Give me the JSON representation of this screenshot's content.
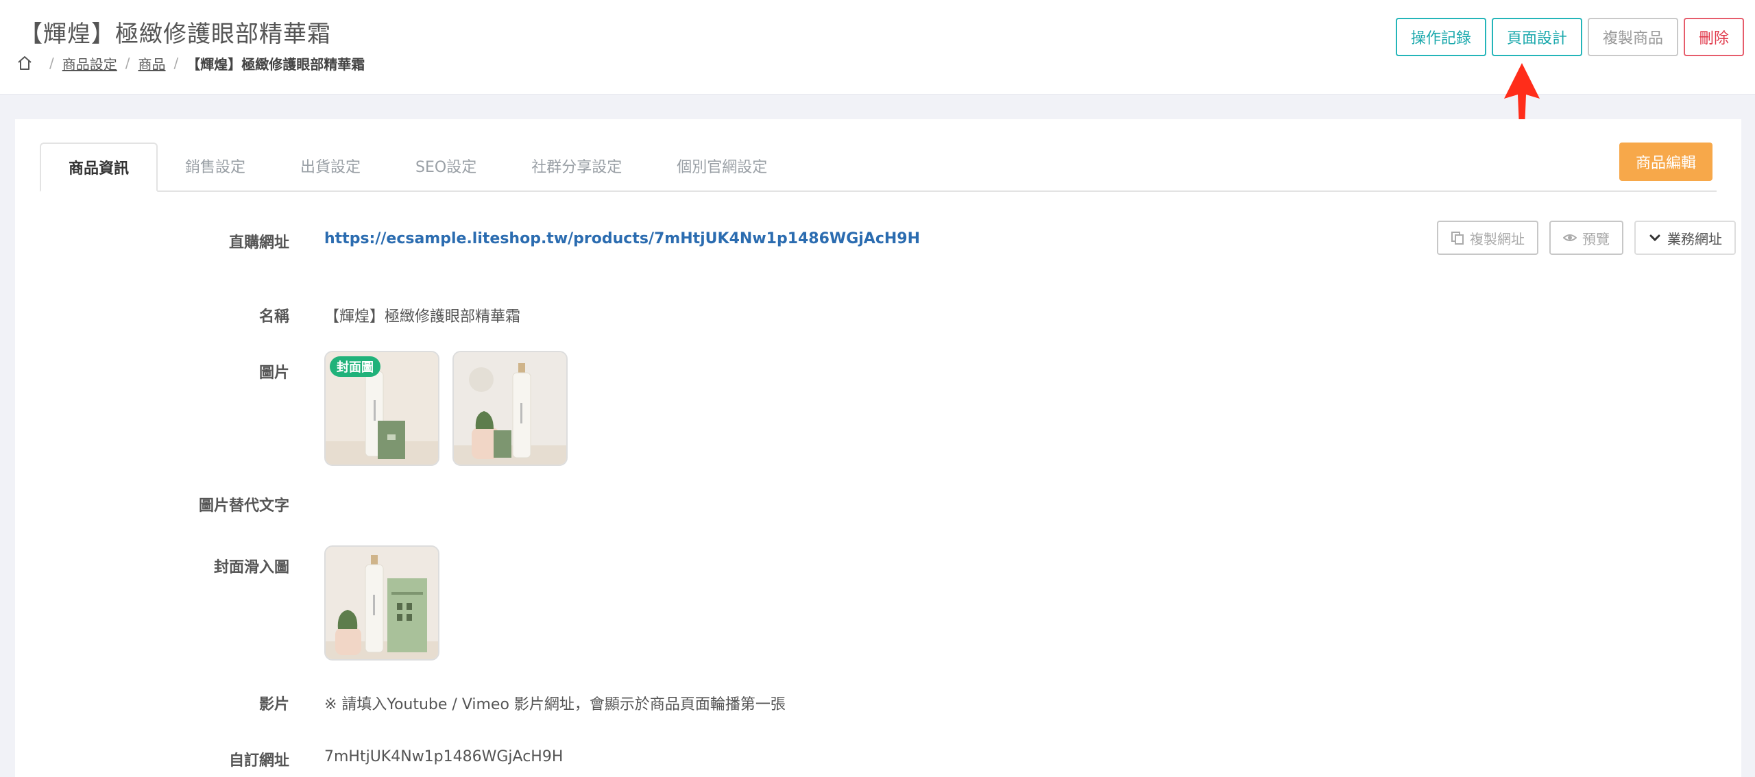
{
  "header": {
    "title": "【輝煌】極緻修護眼部精華霜",
    "breadcrumb": [
      "商品設定",
      "商品",
      "【輝煌】極緻修護眼部精華霜"
    ],
    "actions": [
      "操作記錄",
      "頁面設計",
      "複製商品",
      "刪除"
    ]
  },
  "tabs": [
    "商品資訊",
    "銷售設定",
    "出貨設定",
    "SEO設定",
    "社群分享設定",
    "個別官網設定"
  ],
  "edit_button": "商品編輯",
  "fields": {
    "direct_url": {
      "label": "直購網址",
      "value": "https://ecsample.liteshop.tw/products/7mHtjUK4Nw1p1486WGjAcH9H",
      "copy_button": "複製網址",
      "preview_button": "預覽",
      "business_button": "業務網址"
    },
    "name": {
      "label": "名稱",
      "value": "【輝煌】極緻修護眼部精華霜"
    },
    "images": {
      "label": "圖片",
      "cover_badge": "封面圖"
    },
    "image_alt": {
      "label": "圖片替代文字"
    },
    "cover_hover": {
      "label": "封面滑入圖"
    },
    "video": {
      "label": "影片",
      "hint": "※ 請填入Youtube / Vimeo 影片網址，會顯示於商品頁面輪播第一張"
    },
    "custom_url": {
      "label": "自訂網址",
      "value": "7mHtjUK4Nw1p1486WGjAcH9H"
    }
  },
  "colors": {
    "teal": "#24b5b9",
    "red": "#e0384a",
    "orange": "#f7a84a",
    "link": "#2b6cb0",
    "badge": "#20b27a",
    "annotation": "#ff2d1a"
  },
  "icons": [
    "home-icon",
    "copy-icon",
    "eye-icon",
    "chevron-down-icon",
    "arrow-up-icon"
  ]
}
